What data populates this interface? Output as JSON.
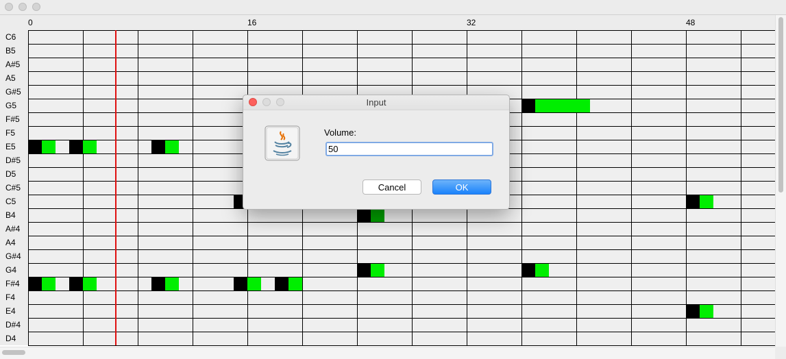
{
  "window": {
    "title": ""
  },
  "ruler": {
    "labels": [
      "0",
      "16",
      "32",
      "48"
    ]
  },
  "keys": [
    "C6",
    "B5",
    "A#5",
    "A5",
    "G#5",
    "G5",
    "F#5",
    "F5",
    "E5",
    "D#5",
    "D5",
    "C#5",
    "C5",
    "B4",
    "A#4",
    "A4",
    "G#4",
    "G4",
    "F#4",
    "F4",
    "E4",
    "D#4",
    "D4"
  ],
  "grid": {
    "columns": 54,
    "beats_per_bar": 4,
    "playhead_column": 6.35
  },
  "notes": [
    {
      "pitch": "E5",
      "start": 0,
      "length": 2
    },
    {
      "pitch": "E5",
      "start": 3,
      "length": 2
    },
    {
      "pitch": "E5",
      "start": 9,
      "length": 2
    },
    {
      "pitch": "F#4",
      "start": 0,
      "length": 2
    },
    {
      "pitch": "F#4",
      "start": 3,
      "length": 2
    },
    {
      "pitch": "F#4",
      "start": 9,
      "length": 2
    },
    {
      "pitch": "F#4",
      "start": 15,
      "length": 2
    },
    {
      "pitch": "F#4",
      "start": 18,
      "length": 2
    },
    {
      "pitch": "C5",
      "start": 15,
      "length": 2
    },
    {
      "pitch": "B4",
      "start": 24,
      "length": 2
    },
    {
      "pitch": "G4",
      "start": 24,
      "length": 2
    },
    {
      "pitch": "G5",
      "start": 36,
      "length": 5
    },
    {
      "pitch": "G4",
      "start": 36,
      "length": 2
    },
    {
      "pitch": "C5",
      "start": 48,
      "length": 2
    },
    {
      "pitch": "E4",
      "start": 48,
      "length": 2
    }
  ],
  "colors": {
    "note_head": "#000000",
    "note_tail": "#00ee00",
    "selected_tail": "#00a000",
    "playhead": "#e01010"
  },
  "dialog": {
    "title": "Input",
    "icon": "java-coffee-cup-icon",
    "label": "Volume:",
    "value": "50",
    "cancel_label": "Cancel",
    "ok_label": "OK"
  }
}
